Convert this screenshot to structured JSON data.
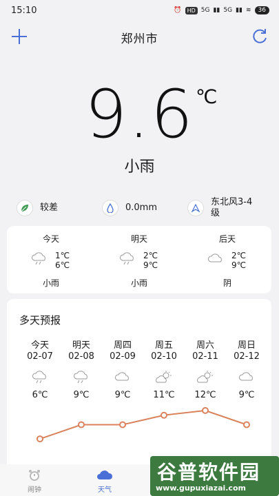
{
  "status": {
    "time": "15:10",
    "hd": "HD",
    "sig1": "5G",
    "sig2": "5G",
    "battery": "36"
  },
  "header": {
    "city": "郑州市"
  },
  "current": {
    "temp": "9.6",
    "unit": "℃",
    "condition": "小雨"
  },
  "metrics": [
    {
      "icon": "leaf-icon",
      "value": "较差"
    },
    {
      "icon": "raindrop-icon",
      "value": "0.0mm"
    },
    {
      "icon": "wind-direction-icon",
      "value": "东北风3-4级"
    }
  ],
  "short_forecast": [
    {
      "day": "今天",
      "low": "1℃",
      "high": "6℃",
      "weather": "小雨",
      "icon": "cloud-rain-icon"
    },
    {
      "day": "明天",
      "low": "2℃",
      "high": "9℃",
      "weather": "小雨",
      "icon": "cloud-rain-icon"
    },
    {
      "day": "后天",
      "low": "2℃",
      "high": "9℃",
      "weather": "阴",
      "icon": "cloud-icon"
    }
  ],
  "multi_forecast": {
    "title": "多天预报",
    "days": [
      {
        "day": "今天",
        "date": "02-07",
        "temp": "6℃",
        "icon": "cloud-rain-icon"
      },
      {
        "day": "明天",
        "date": "02-08",
        "temp": "9℃",
        "icon": "cloud-rain-icon"
      },
      {
        "day": "周四",
        "date": "02-09",
        "temp": "9℃",
        "icon": "cloud-icon"
      },
      {
        "day": "周五",
        "date": "02-10",
        "temp": "11℃",
        "icon": "sun-cloud-icon"
      },
      {
        "day": "周六",
        "date": "02-11",
        "temp": "12℃",
        "icon": "sun-cloud-icon"
      },
      {
        "day": "周日",
        "date": "02-12",
        "temp": "9℃",
        "icon": "cloud-icon"
      }
    ],
    "trend_values": [
      6,
      9,
      9,
      11,
      12,
      9
    ],
    "trend_color": "#d9825b"
  },
  "tabs": [
    {
      "label": "闹钟",
      "icon": "alarm-clock-icon",
      "active": false
    },
    {
      "label": "天气",
      "icon": "weather-cloud-icon",
      "active": true
    }
  ],
  "colors": {
    "accent": "#4a6fd6",
    "leaf": "#3e9b52"
  },
  "watermark": {
    "text": "谷普软件园",
    "url": "www.gupuxiazai.com"
  }
}
